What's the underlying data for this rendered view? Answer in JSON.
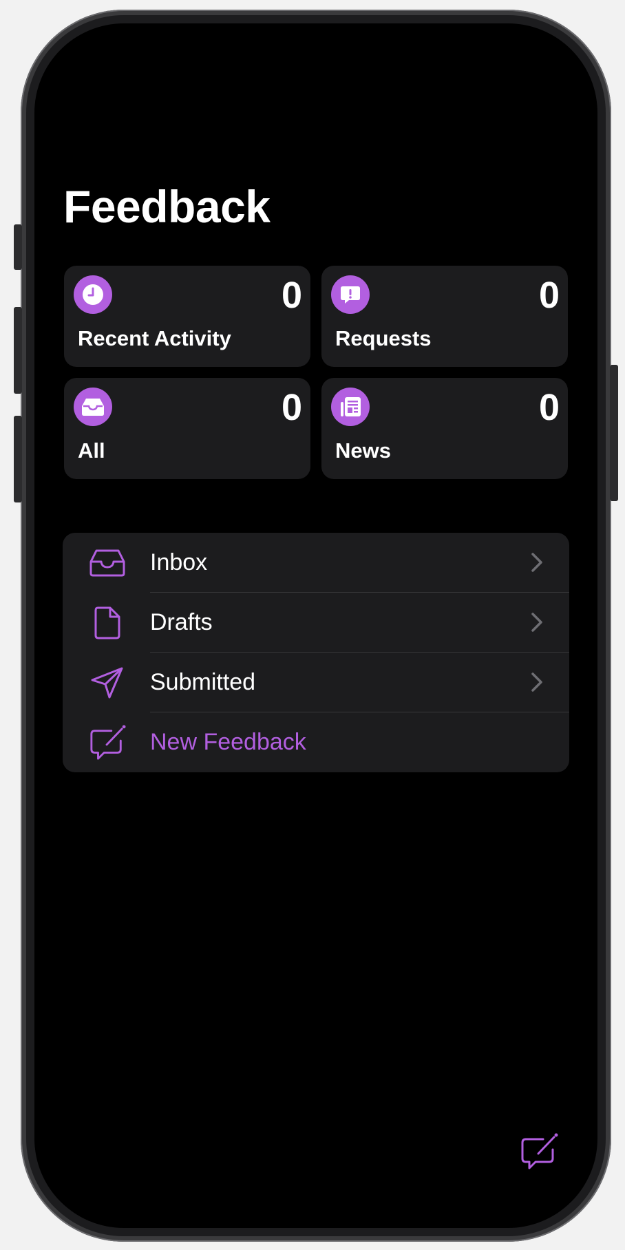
{
  "header": {
    "title": "Feedback"
  },
  "tiles": [
    {
      "label": "Recent Activity",
      "count": "0",
      "icon": "clock-icon"
    },
    {
      "label": "Requests",
      "count": "0",
      "icon": "exclamation-bubble-icon"
    },
    {
      "label": "All",
      "count": "0",
      "icon": "tray-icon"
    },
    {
      "label": "News",
      "count": "0",
      "icon": "newspaper-icon"
    }
  ],
  "list": {
    "items": [
      {
        "label": "Inbox",
        "icon": "inbox-icon"
      },
      {
        "label": "Drafts",
        "icon": "document-icon"
      },
      {
        "label": "Submitted",
        "icon": "paper-plane-icon"
      },
      {
        "label": "New Feedback",
        "icon": "compose-icon"
      }
    ]
  },
  "colors": {
    "accent": "#b25fe0",
    "background": "#000000",
    "card": "#1c1c1e"
  }
}
